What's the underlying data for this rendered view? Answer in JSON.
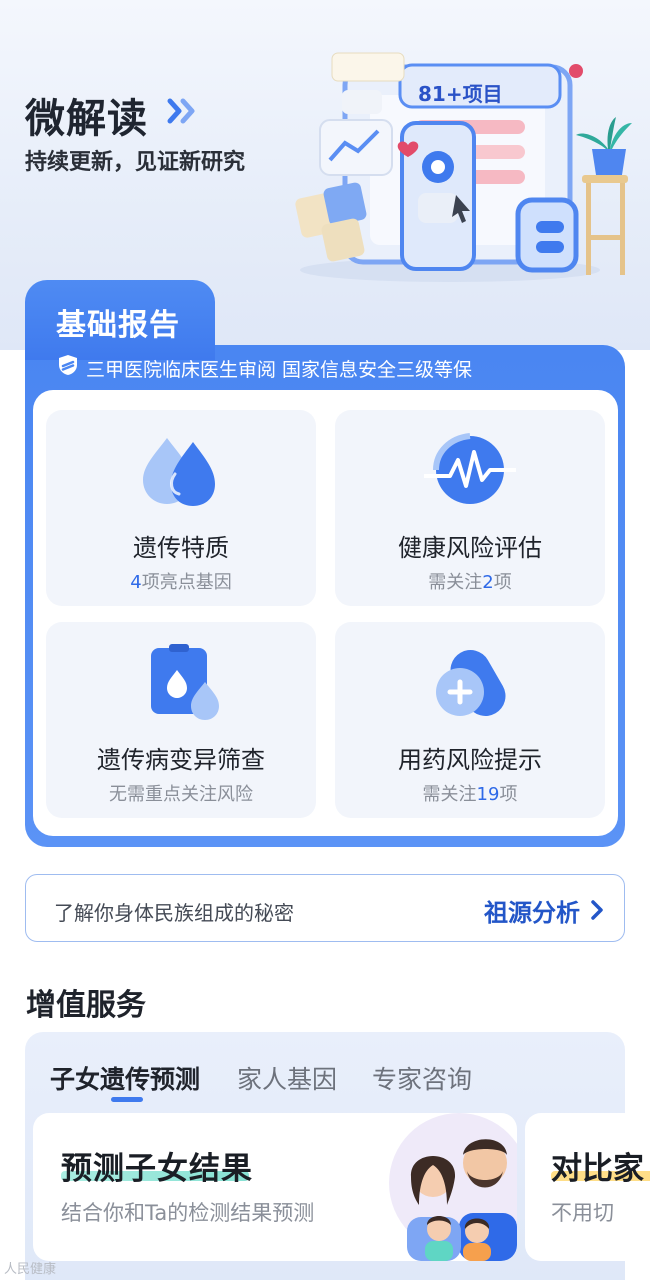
{
  "hero": {
    "title": "微解读",
    "subtitle": "持续更新，见证新研究",
    "badge": "81+项目"
  },
  "report": {
    "tab_title": "基础报告",
    "certification": "三甲医院临床医生审阅 国家信息安全三级等保",
    "tiles": [
      {
        "title": "遗传特质",
        "sub_pre": "",
        "sub_num": "4",
        "sub_post": "项亮点基因",
        "icon": "water-drops-icon"
      },
      {
        "title": "健康风险评估",
        "sub_pre": "需关注",
        "sub_num": "2",
        "sub_post": "项",
        "icon": "heartbeat-icon"
      },
      {
        "title": "遗传病变异筛查",
        "sub_pre": "无需重点关注风险",
        "sub_num": "",
        "sub_post": "",
        "icon": "clipboard-drop-icon"
      },
      {
        "title": "用药风险提示",
        "sub_pre": "需关注",
        "sub_num": "19",
        "sub_post": "项",
        "icon": "pill-plus-icon"
      }
    ]
  },
  "ancestry": {
    "text": "了解你身体民族组成的秘密",
    "link": "祖源分析"
  },
  "services": {
    "title": "增值服务",
    "tabs": [
      "子女遗传预测",
      "家人基因",
      "专家咨询"
    ],
    "active_tab": 0,
    "cards": [
      {
        "title": "预测子女结果",
        "desc": "结合你和Ta的检测结果预测"
      },
      {
        "title": "对比家",
        "desc": "不用切"
      }
    ]
  },
  "watermark": "人民健康",
  "colors": {
    "primary": "#4a86f2",
    "link": "#2356c8",
    "highlight": "#2f6ae8"
  }
}
